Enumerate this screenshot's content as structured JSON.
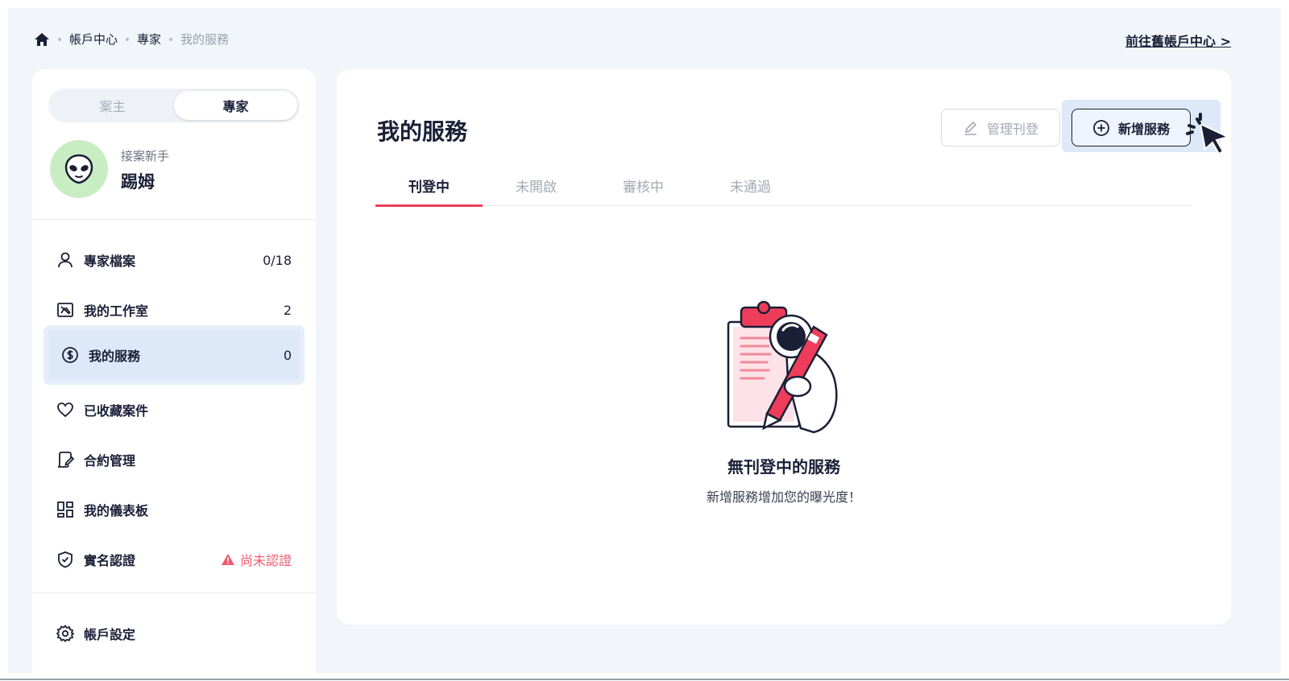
{
  "breadcrumb": {
    "items": [
      "帳戶中心",
      "專家"
    ],
    "current": "我的服務"
  },
  "header": {
    "old_center_link": "前往舊帳戶中心 >"
  },
  "sidebar": {
    "roles": [
      "案主",
      "專家"
    ],
    "active_role": "專家",
    "profile": {
      "level": "接案新手",
      "name": "踢姆"
    },
    "items": [
      {
        "label": "專家檔案",
        "count": "0/18",
        "icon": "user-icon"
      },
      {
        "label": "我的工作室",
        "count": "2",
        "icon": "studio-icon"
      },
      {
        "label": "我的服務",
        "count": "0",
        "icon": "dollar-icon",
        "active": true
      },
      {
        "label": "已收藏案件",
        "count": "",
        "icon": "heart-icon"
      },
      {
        "label": "合約管理",
        "count": "",
        "icon": "contract-icon"
      },
      {
        "label": "我的儀表板",
        "count": "",
        "icon": "dashboard-icon"
      },
      {
        "label": "實名認證",
        "count": "",
        "icon": "shield-check-icon",
        "warning": "尚未認證"
      }
    ],
    "settings_label": "帳戶設定"
  },
  "main": {
    "title": "我的服務",
    "manage_button": "管理刊登",
    "add_button": "新增服務",
    "tabs": [
      "刊登中",
      "未開啟",
      "審核中",
      "未通過"
    ],
    "active_tab": "刊登中",
    "empty_title": "無刊登中的服務",
    "empty_subtitle": "新增服務增加您的曝光度！"
  },
  "colors": {
    "accent": "#ee3d5a",
    "active_bg": "#dde9f8",
    "warning": "#ef5a6f",
    "avatar_bg": "#c8edc2"
  }
}
